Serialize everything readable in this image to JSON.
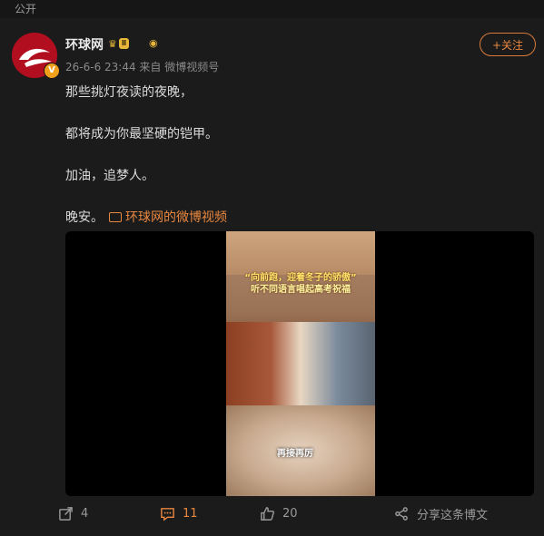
{
  "header": {
    "visibility": "公开"
  },
  "post": {
    "author": "环球网",
    "vip_level": "Ⅱ",
    "meta": "26-6-6 23:44  来自 微博视频号",
    "follow_label": "+关注",
    "lines": [
      "那些挑灯夜读的夜晚，",
      "都将成为你最坚硬的铠甲。",
      "加油，追梦人。",
      "晚安。"
    ],
    "source_link": "环球网的微博视频",
    "video": {
      "caption_line1": "“向前跑，迎着冬子的骄傲”",
      "caption_line2": "听不同语言唱起高考祝福",
      "watermark": "再接再厉"
    }
  },
  "actions": {
    "forward": "4",
    "comment": "11",
    "like": "20",
    "share": "分享这条博文"
  },
  "colors": {
    "accent": "#e8873f",
    "background": "#1b1b1b",
    "verified": "#f0a01b"
  },
  "icons": [
    "avatar-logo",
    "verified-icon",
    "vip-crown-icon",
    "video-icon",
    "forward-icon",
    "comment-icon",
    "like-icon",
    "share-icon"
  ]
}
